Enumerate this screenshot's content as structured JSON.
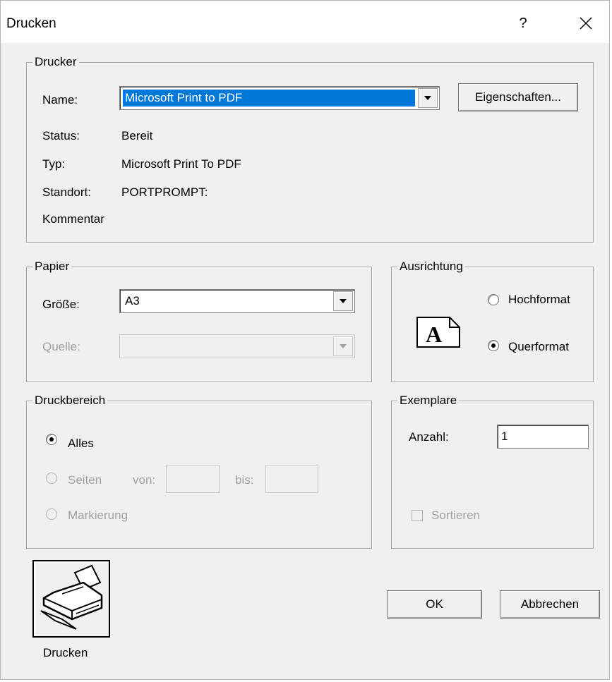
{
  "window": {
    "title": "Drucken",
    "help_label": "?",
    "close_icon": "close-icon"
  },
  "printer": {
    "group_label": "Drucker",
    "name_label": "Name:",
    "name_value": "Microsoft Print to PDF",
    "properties_button": "Eigenschaften...",
    "status_label": "Status:",
    "status_value": "Bereit",
    "type_label": "Typ:",
    "type_value": "Microsoft Print To PDF",
    "location_label": "Standort:",
    "location_value": "PORTPROMPT:",
    "comment_label": "Kommentar"
  },
  "paper": {
    "group_label": "Papier",
    "size_label": "Größe:",
    "size_value": "A3",
    "source_label": "Quelle:",
    "source_value": ""
  },
  "orientation": {
    "group_label": "Ausrichtung",
    "icon_letter": "A",
    "portrait_label": "Hochformat",
    "landscape_label": "Querformat",
    "selected": "landscape"
  },
  "print_range": {
    "group_label": "Druckbereich",
    "all_label": "Alles",
    "pages_label": "Seiten",
    "from_label": "von:",
    "to_label": "bis:",
    "from_value": "",
    "to_value": "",
    "selection_label": "Markierung",
    "selected": "all"
  },
  "copies": {
    "group_label": "Exemplare",
    "count_label": "Anzahl:",
    "count_value": "1",
    "collate_label": "Sortieren",
    "collate_checked": false
  },
  "actions": {
    "print_icon_label": "Drucken",
    "ok_button": "OK",
    "cancel_button": "Abbrechen"
  },
  "colors": {
    "dialog_bg": "#f0f0f0",
    "selection_bg": "#0078d7",
    "disabled_text": "#a0a0a0"
  }
}
